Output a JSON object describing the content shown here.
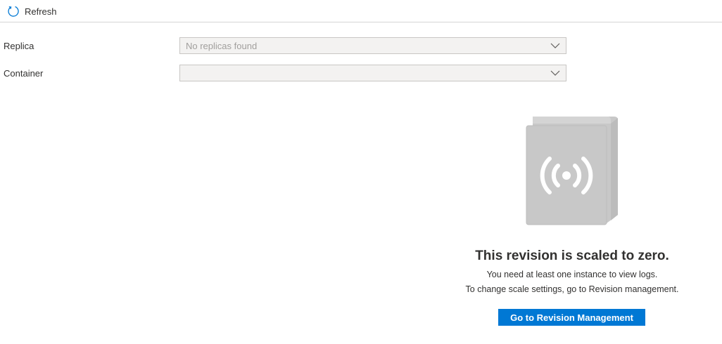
{
  "toolbar": {
    "refresh_label": "Refresh",
    "refresh_icon": "refresh-icon"
  },
  "fields": {
    "replica": {
      "label": "Replica",
      "value": "No replicas found"
    },
    "container": {
      "label": "Container",
      "value": ""
    }
  },
  "empty_state": {
    "icon": "log-book-broadcast-icon",
    "title": "This revision is scaled to zero.",
    "line1": "You need at least one instance to view logs.",
    "line2": "To change scale settings, go to Revision management.",
    "button_label": "Go to Revision Management"
  },
  "colors": {
    "accent": "#0078d4",
    "illustration": "#c8c8c8"
  }
}
